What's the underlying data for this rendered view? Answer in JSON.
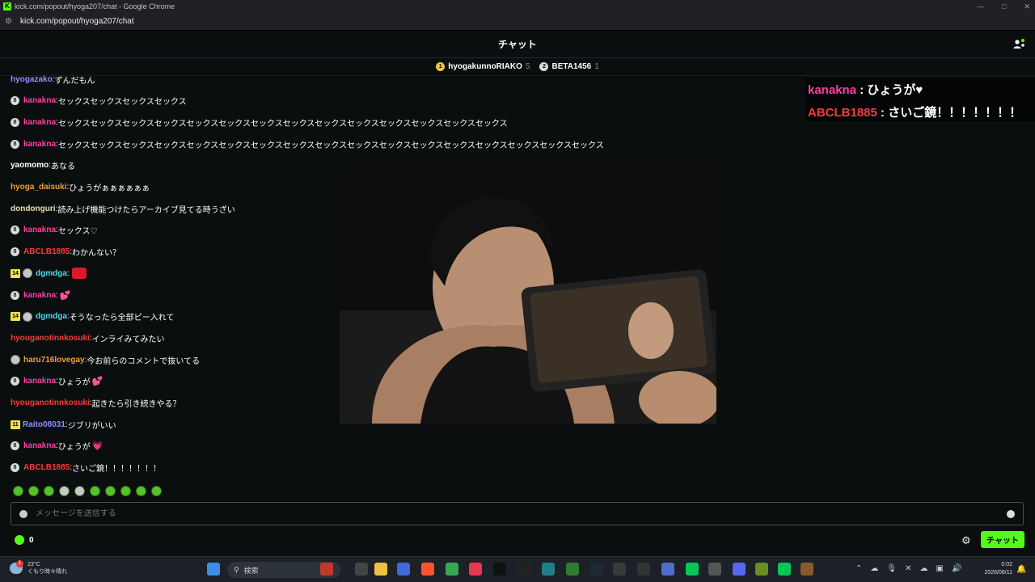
{
  "window": {
    "title": "kick.com/popout/hyoga207/chat - Google Chrome",
    "url": "kick.com/popout/hyoga207/chat",
    "logo_letter": "K"
  },
  "chat": {
    "header_title": "チャット",
    "pinned_gifters": [
      {
        "name": "hyogakunnoRIAKO",
        "count": "5",
        "medal": "1",
        "medal_color": "#f5c542"
      },
      {
        "name": "BETA1456",
        "count": "1",
        "medal": "2",
        "medal_color": "#d9d9d9"
      }
    ],
    "messages": [
      {
        "badges": [],
        "user": "hyogazako",
        "color": "#8f8fff",
        "text": "ずんだもん"
      },
      {
        "badges": [
          "sub"
        ],
        "user": "kanakna",
        "color": "#ff3fa4",
        "text": "セックスセックスセックスセックス"
      },
      {
        "badges": [
          "sub"
        ],
        "user": "kanakna",
        "color": "#ff3fa4",
        "text": "セックスセックスセックスセックスセックスセックスセックスセックスセックスセックスセックスセックスセックスセックス"
      },
      {
        "badges": [
          "sub"
        ],
        "user": "kanakna",
        "color": "#ff3fa4",
        "text": "セックスセックスセックスセックスセックスセックスセックスセックスセックスセックスセックスセックスセックスセックスセックスセックスセックス"
      },
      {
        "badges": [],
        "user": "yaomomo",
        "color": "#ffffff",
        "text": "あなる"
      },
      {
        "badges": [],
        "user": "hyoga_daisuki",
        "color": "#f0a030",
        "text": "ひょうがぁぁぁぁぁぁ"
      },
      {
        "badges": [],
        "user": "dondonguri",
        "color": "#e8e0b0",
        "text": "読み上げ機能つけたらアーカイブ見てる時うざい"
      },
      {
        "badges": [
          "sub"
        ],
        "user": "kanakna",
        "color": "#ff3fa4",
        "text": "セックス♡"
      },
      {
        "badges": [
          "sub"
        ],
        "user": "ABCLB1885",
        "color": "#ff3838",
        "text": "わかんない？"
      },
      {
        "badges": [
          "14",
          "av"
        ],
        "user": "dgmdga",
        "color": "#4fd9e8",
        "text": "",
        "emote": "red"
      },
      {
        "badges": [
          "sub"
        ],
        "user": "kanakna",
        "color": "#ff3fa4",
        "text": "",
        "heart": "💕"
      },
      {
        "badges": [
          "14",
          "av"
        ],
        "user": "dgmdga",
        "color": "#4fd9e8",
        "text": "そうなったら全部ピー入れて"
      },
      {
        "badges": [],
        "user": "hyouganotinnkosuki",
        "color": "#ff3838",
        "text": "インライみてみたい"
      },
      {
        "badges": [
          "av"
        ],
        "user": "haru716lovegay",
        "color": "#f0a030",
        "text": "今お前らのコメントで抜いてる"
      },
      {
        "badges": [
          "sub"
        ],
        "user": "kanakna",
        "color": "#ff3fa4",
        "text": "ひょうが",
        "heart": "💕"
      },
      {
        "badges": [],
        "user": "hyouganotinnkosuki",
        "color": "#ff3838",
        "text": "起きたら引き続きやる？"
      },
      {
        "badges": [
          "11"
        ],
        "user": "Raito08031",
        "color": "#8f8fff",
        "text": "ジブリがいい"
      },
      {
        "badges": [
          "sub"
        ],
        "user": "kanakna",
        "color": "#ff3fa4",
        "text": "ひょうが",
        "heart": "💗"
      },
      {
        "badges": [
          "sub"
        ],
        "user": "ABCLB1885",
        "color": "#ff3838",
        "text": "さいご鏡！！！！！！！"
      }
    ],
    "overlay": [
      {
        "user": "kanakna",
        "color": "#ff3fa4",
        "sep": ":",
        "text": "ひょうが♥"
      },
      {
        "user": "ABCLB1885",
        "color": "#ff3838",
        "sep": ":",
        "text": "さいご鏡！！！！！！！"
      }
    ],
    "input_placeholder": "メッセージを送信する",
    "points": "0",
    "send_label": "チャット"
  },
  "taskbar": {
    "weather_temp": "23°C",
    "weather_desc": "くもり時々晴れ",
    "weather_badge": "1",
    "search_label": "検索",
    "clock_time": "0:02",
    "clock_date": "2026/08/11"
  }
}
